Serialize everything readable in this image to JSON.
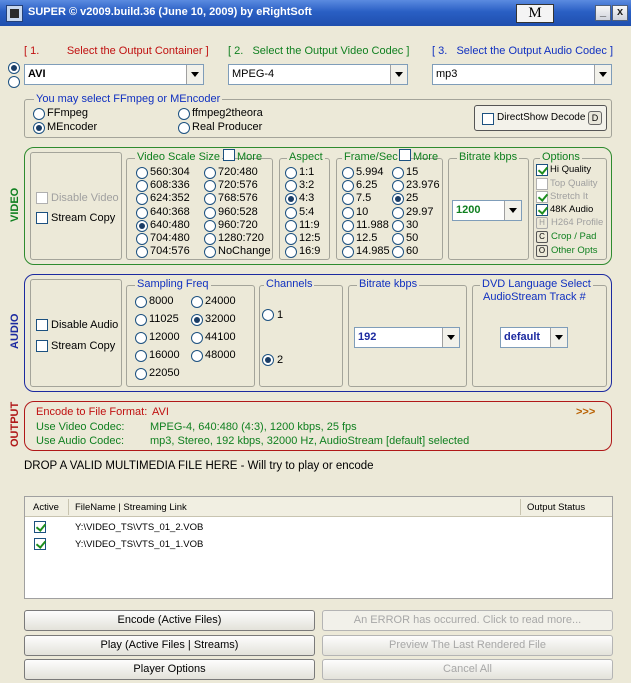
{
  "window": {
    "title": "SUPER © v2009.build.36 (June 10, 2009) by eRightSoft",
    "m_label": "M",
    "minimize": "_",
    "close": "x"
  },
  "steps": {
    "s1": {
      "num": "[ 1.",
      "label": "Select the Output Container ]"
    },
    "s2": {
      "num": "[ 2.",
      "label": "Select the Output Video Codec ]"
    },
    "s3": {
      "num": "[ 3.",
      "label": "Select the Output Audio Codec ]"
    }
  },
  "container": {
    "value": "AVI"
  },
  "video_codec": {
    "value": "MPEG-4"
  },
  "audio_codec": {
    "value": "mp3"
  },
  "encoder": {
    "title": "You may select FFmpeg or MEncoder",
    "options": [
      "FFmpeg",
      "MEncoder",
      "ffmpeg2theora",
      "Real Producer"
    ],
    "selected": "MEncoder",
    "directshow": "DirectShow Decode",
    "directshow_badge": "D"
  },
  "video": {
    "section": "VIDEO",
    "disable_video": "Disable Video",
    "stream_copy": "Stream Copy",
    "scale": {
      "title": "Video Scale Size",
      "more": "More",
      "col1": [
        "560:304",
        "608:336",
        "624:352",
        "640:368",
        "640:480",
        "704:480",
        "704:576"
      ],
      "col2": [
        "720:480",
        "720:576",
        "768:576",
        "960:528",
        "960:720",
        "1280:720",
        "NoChange"
      ],
      "selected": "640:480"
    },
    "aspect": {
      "title": "Aspect",
      "options": [
        "1:1",
        "3:2",
        "4:3",
        "5:4",
        "11:9",
        "12:5",
        "16:9"
      ],
      "selected": "4:3"
    },
    "fps": {
      "title": "Frame/Sec",
      "more": "More",
      "col1": [
        "5.994",
        "6.25",
        "7.5",
        "10",
        "11.988",
        "12.5",
        "14.985"
      ],
      "col2": [
        "15",
        "23.976",
        "25",
        "29.97",
        "30",
        "50",
        "60"
      ],
      "selected": "25"
    },
    "bitrate": {
      "title": "Bitrate  kbps",
      "value": "1200"
    },
    "options": {
      "title": "Options",
      "hi_quality": "Hi Quality",
      "top_quality": "Top Quality",
      "stretch": "Stretch It",
      "audio48k": "48K Audio",
      "h264": "H264 Profile",
      "crop_badge": "C",
      "crop": "Crop / Pad",
      "other_badge": "O",
      "other": "Other Opts"
    }
  },
  "audio": {
    "section": "AUDIO",
    "disable_audio": "Disable Audio",
    "stream_copy": "Stream Copy",
    "sampling": {
      "title": "Sampling Freq",
      "col1": [
        "8000",
        "11025",
        "12000",
        "16000",
        "22050"
      ],
      "col2": [
        "24000",
        "32000",
        "44100",
        "48000"
      ],
      "selected": "32000"
    },
    "channels": {
      "title": "Channels",
      "options": [
        "1",
        "2"
      ],
      "selected": "2"
    },
    "bitrate": {
      "title": "Bitrate  kbps",
      "value": "192"
    },
    "dvd": {
      "title1": "DVD Language Select",
      "title2": "AudioStream  Track #",
      "value": "default"
    }
  },
  "output": {
    "section": "OUTPUT",
    "format_label": "Encode to File Format:",
    "format_value": "AVI",
    "more": ">>>",
    "video_label": "Use Video Codec:",
    "video_value": "MPEG-4,  640:480 (4:3),  1200 kbps,  25 fps",
    "audio_label": "Use Audio Codec:",
    "audio_value": "mp3,  Stereo,  192 kbps,  32000 Hz,  AudioStream [default] selected"
  },
  "drop_text": "DROP A VALID MULTIMEDIA FILE HERE - Will try to play or encode",
  "files": {
    "headers": {
      "active": "Active",
      "filename": "FileName  |  Streaming Link",
      "status": "Output Status"
    },
    "rows": [
      {
        "path": "Y:\\VIDEO_TS\\VTS_01_2.VOB"
      },
      {
        "path": "Y:\\VIDEO_TS\\VTS_01_1.VOB"
      }
    ]
  },
  "buttons": {
    "encode": "Encode (Active Files)",
    "error": "An ERROR has occurred. Click to read more...",
    "play": "Play (Active Files | Streams)",
    "preview": "Preview The Last Rendered File",
    "player_options": "Player Options",
    "cancel": "Cancel All"
  },
  "colors": {
    "video_border": "#2e8b2e",
    "audio_border": "#1c2aa0",
    "output_border": "#b01818",
    "step_red": "#c01010",
    "step_green": "#108020",
    "step_blue": "#1030c0"
  }
}
